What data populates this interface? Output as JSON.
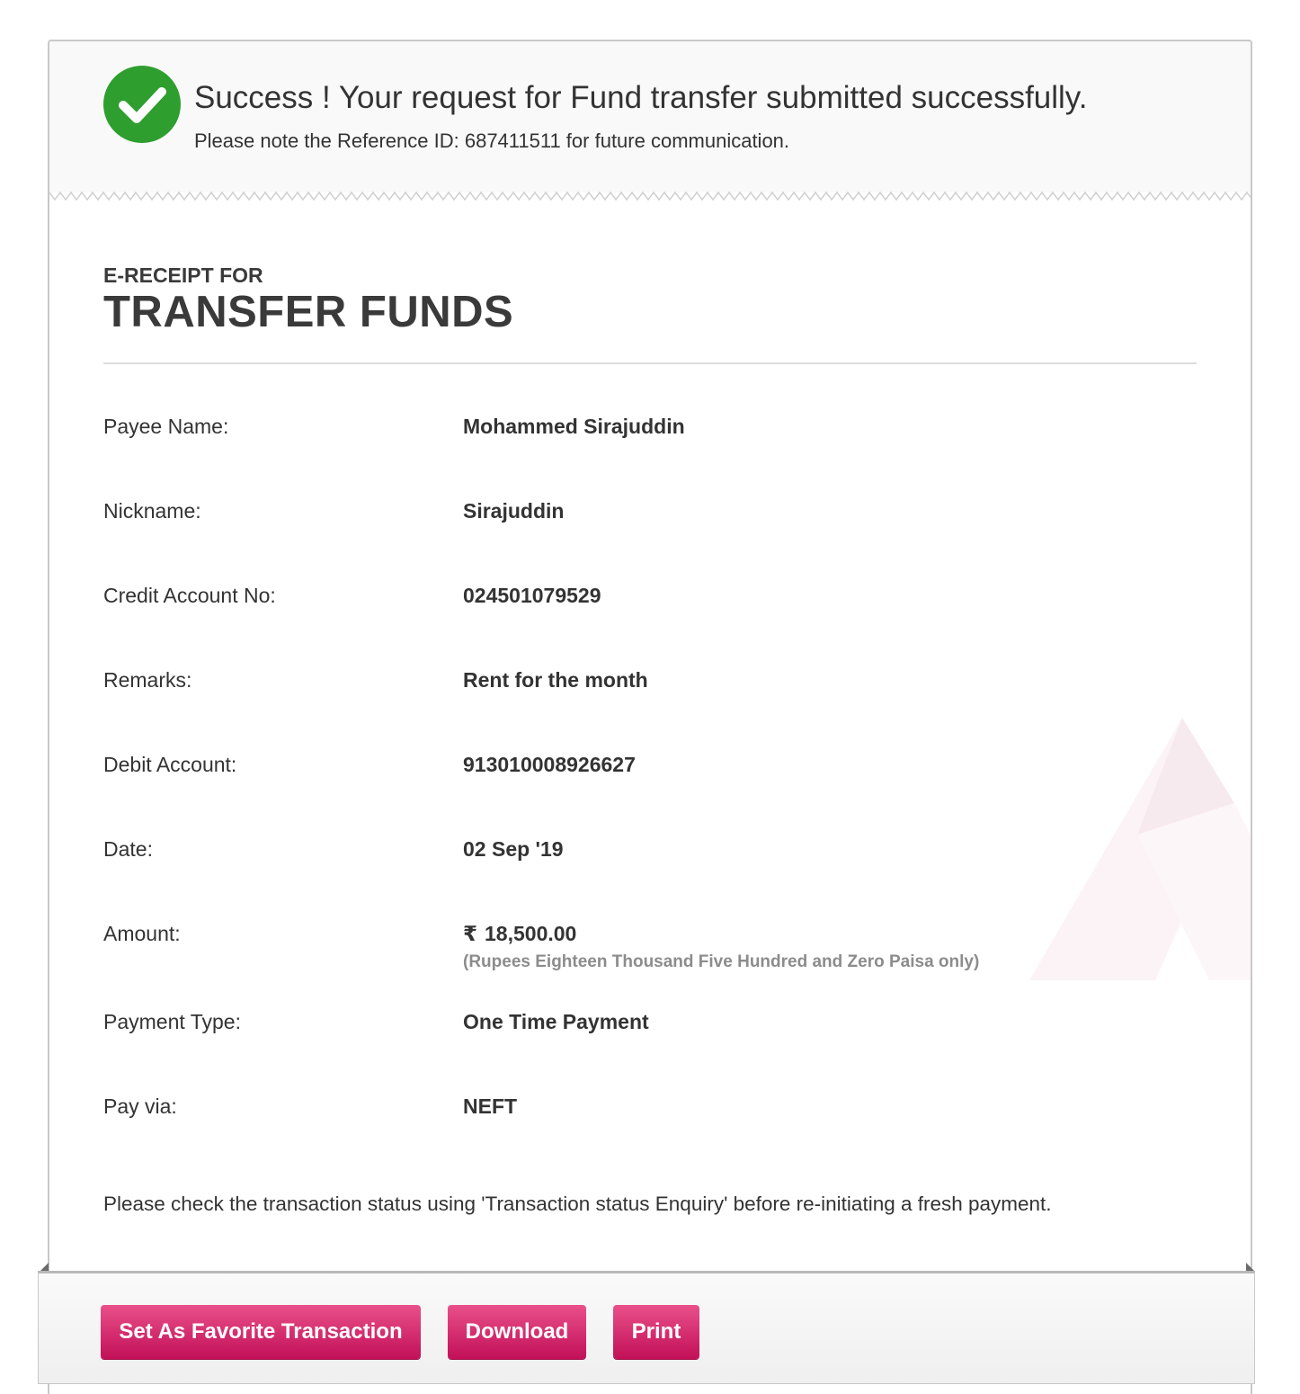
{
  "success": {
    "title": "Success ! Your request for Fund transfer submitted successfully.",
    "message": "Please note the Reference ID: 687411511 for future communication.",
    "icon": "check-circle-icon",
    "accent_color": "#2e9e2e"
  },
  "receipt": {
    "kicker": "E-RECEIPT FOR",
    "title": "TRANSFER FUNDS"
  },
  "details": {
    "payee_name": {
      "label": "Payee Name:",
      "value": "Mohammed Sirajuddin"
    },
    "nickname": {
      "label": "Nickname:",
      "value": "Sirajuddin"
    },
    "credit_account": {
      "label": "Credit Account No:",
      "value": "024501079529"
    },
    "remarks": {
      "label": "Remarks:",
      "value": "Rent for the month"
    },
    "debit_account": {
      "label": "Debit Account:",
      "value": "913010008926627"
    },
    "date": {
      "label": "Date:",
      "value": "02 Sep '19"
    },
    "amount": {
      "label": "Amount:",
      "currency_symbol": "₹",
      "value": "18,500.00",
      "in_words": "(Rupees Eighteen Thousand Five Hundred and Zero Paisa only)"
    },
    "payment_type": {
      "label": "Payment Type:",
      "value": "One Time Payment"
    },
    "pay_via": {
      "label": "Pay via:",
      "value": "NEFT"
    }
  },
  "note": "Please check the transaction status using 'Transaction status Enquiry' before re-initiating a fresh payment.",
  "actions": {
    "favorite_label": "Set As Favorite Transaction",
    "download_label": "Download",
    "print_label": "Print",
    "button_color": "#c21058"
  }
}
